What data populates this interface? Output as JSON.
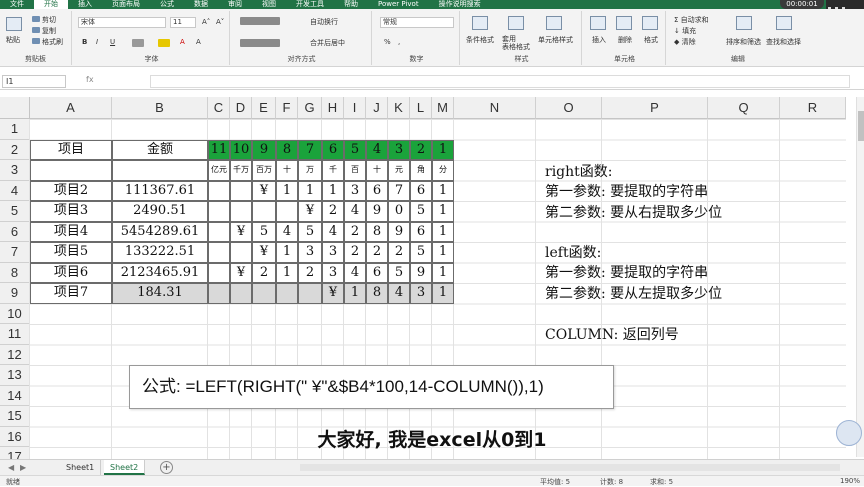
{
  "ribbon_tabs": [
    "文件",
    "开始",
    "插入",
    "页面布局",
    "公式",
    "数据",
    "审阅",
    "视图",
    "开发工具",
    "帮助",
    "Power Pivot",
    "操作说明搜索"
  ],
  "active_tab": "开始",
  "recording_timer": "00:00:01",
  "ribbon": {
    "clipboard": {
      "paste": "粘贴",
      "cut": "剪切",
      "copy": "复制",
      "format_painter": "格式刷",
      "label": "剪贴板"
    },
    "font": {
      "name": "宋体",
      "size": "11",
      "label": "字体",
      "buttons": [
        "B",
        "I",
        "U",
        "A",
        "A"
      ]
    },
    "alignment": {
      "wrap": "自动换行",
      "merge": "合并后居中",
      "label": "对齐方式"
    },
    "number": {
      "format": "常规",
      "label": "数字",
      "buttons": [
        "%",
        ","
      ]
    },
    "styles": {
      "conditional": "条件格式",
      "table": "套用\n表格格式",
      "cell_styles": "单元格样式",
      "label": "样式"
    },
    "cells": {
      "insert": "插入",
      "delete": "删除",
      "format": "格式",
      "label": "单元格"
    },
    "editing": {
      "autosum": "自动求和",
      "fill": "填充",
      "clear": "清除",
      "sort": "排序和筛选",
      "find": "查找和选择",
      "label": "编辑"
    }
  },
  "formula_bar": {
    "name_box": "I1",
    "fx": "fx",
    "value": ""
  },
  "columns": [
    "A",
    "B",
    "C",
    "D",
    "E",
    "F",
    "G",
    "H",
    "I",
    "J",
    "K",
    "L",
    "M",
    "N",
    "O",
    "P",
    "Q",
    "R"
  ],
  "rows": [
    "1",
    "2",
    "3",
    "4",
    "5",
    "6",
    "7",
    "8",
    "9",
    "10",
    "11",
    "12",
    "13",
    "14",
    "15",
    "16",
    "17"
  ],
  "header_row": {
    "item": "项目",
    "amount": "金额",
    "digits": [
      "11",
      "10",
      "9",
      "8",
      "7",
      "6",
      "5",
      "4",
      "3",
      "2",
      "1"
    ]
  },
  "units": [
    "亿元",
    "千万",
    "百万",
    "十",
    "万",
    "千",
    "百",
    "十",
    "元",
    "角",
    "分"
  ],
  "data_rows": [
    {
      "item": "项目2",
      "amount": "111367.61",
      "digits": [
        "",
        "",
        "¥",
        "1",
        "1",
        "1",
        "3",
        "6",
        "7",
        "6",
        "1"
      ]
    },
    {
      "item": "项目3",
      "amount": "2490.51",
      "digits": [
        "",
        "",
        "",
        "",
        "¥",
        "2",
        "4",
        "9",
        "0",
        "5",
        "1"
      ]
    },
    {
      "item": "项目4",
      "amount": "5454289.61",
      "digits": [
        "",
        "¥",
        "5",
        "4",
        "5",
        "4",
        "2",
        "8",
        "9",
        "6",
        "1"
      ]
    },
    {
      "item": "项目5",
      "amount": "133222.51",
      "digits": [
        "",
        "",
        "¥",
        "1",
        "3",
        "3",
        "2",
        "2",
        "2",
        "5",
        "1"
      ]
    },
    {
      "item": "项目6",
      "amount": "2123465.91",
      "digits": [
        "",
        "¥",
        "2",
        "1",
        "2",
        "3",
        "4",
        "6",
        "5",
        "9",
        "1"
      ]
    },
    {
      "item": "项目7",
      "amount": "184.31",
      "digits": [
        "",
        "",
        "",
        "",
        "",
        "¥",
        "1",
        "8",
        "4",
        "3",
        "1"
      ]
    }
  ],
  "notes": {
    "right_title": "right函数:",
    "right_p1": "第一参数: 要提取的字符串",
    "right_p2": "第二参数: 要从右提取多少位",
    "left_title": "left函数:",
    "left_p1": "第一参数: 要提取的字符串",
    "left_p2": "第二参数: 要从左提取多少位",
    "column": "COLUMN: 返回列号"
  },
  "formula_overlay": "公式: =LEFT(RIGHT(\" ¥\"&$B4*100,14-COLUMN()),1)",
  "subtitle": "大家好, 我是excel从0到1",
  "sheets": [
    "Sheet1",
    "Sheet2"
  ],
  "active_sheet": "Sheet2",
  "status": {
    "mode": "就绪",
    "average": "平均值: 5",
    "count": "计数: 8",
    "sum": "求和: 5",
    "zoom": "190%"
  },
  "colors": {
    "accent": "#217346",
    "green_fill": "#1aa33b",
    "gray_fill": "#d9d9d9"
  }
}
